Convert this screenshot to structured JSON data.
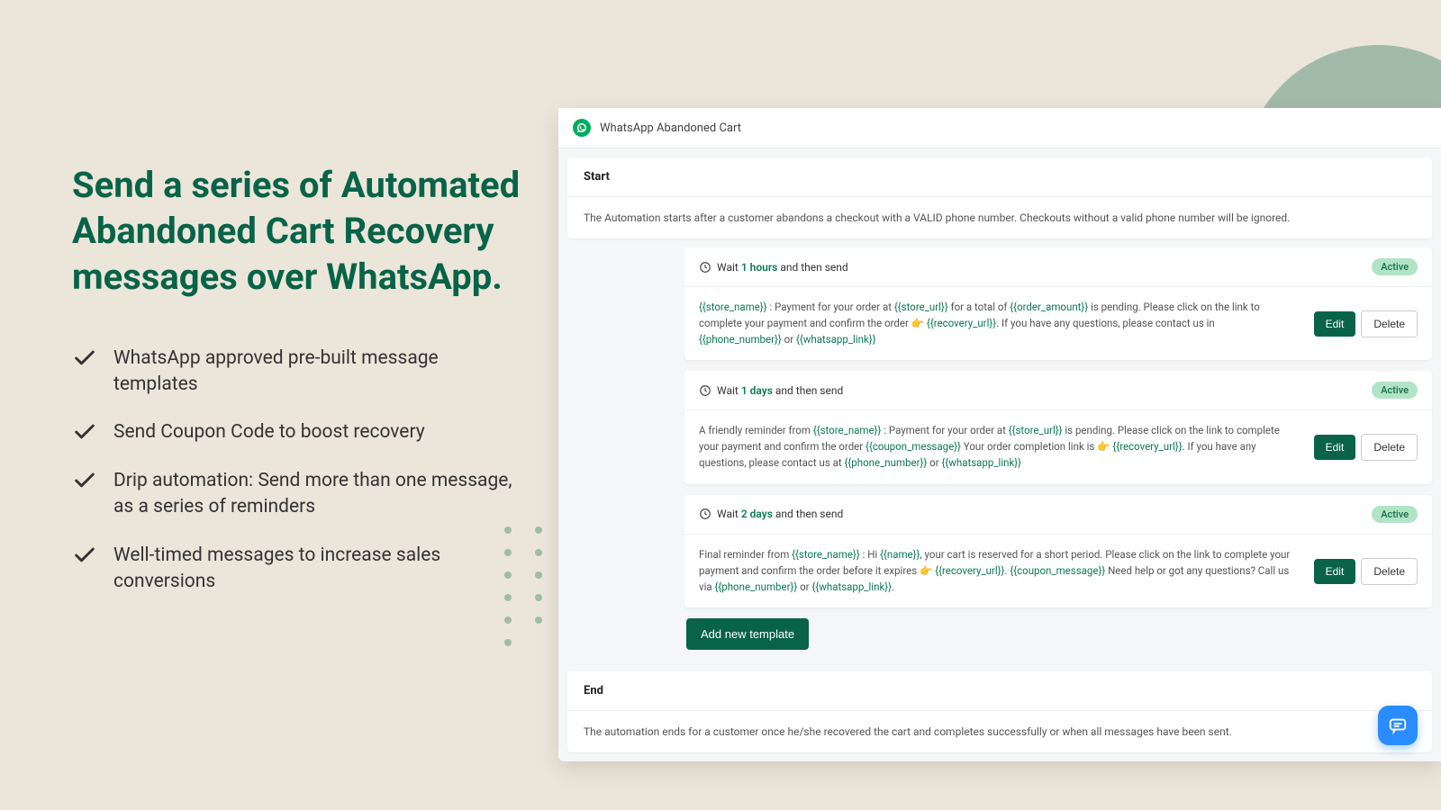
{
  "headline": "Send a series of Automated Abandoned Cart Recovery messages over WhatsApp.",
  "features": [
    "WhatsApp approved pre-built message templates",
    "Send Coupon Code to boost recovery",
    "Drip automation: Send more than one message, as a series of reminders",
    "Well-timed messages to increase sales conversions"
  ],
  "app": {
    "title": "WhatsApp Abandoned Cart",
    "start_label": "Start",
    "start_text": "The Automation starts after a customer abandons a checkout with a VALID phone number. Checkouts without a valid phone number will be ignored.",
    "end_label": "End",
    "end_text": "The automation ends for a customer once he/she recovered the cart and completes successfully or when all messages have been sent.",
    "wait_prefix": "Wait",
    "wait_suffix": "and then send",
    "active_label": "Active",
    "edit_label": "Edit",
    "delete_label": "Delete",
    "add_label": "Add new template",
    "steps": [
      {
        "wait": "1 hours",
        "msg_a": "{{store_name}} : Payment for your order at {{store_url}} for a total of {{order_amount}} is pending. Please click on the link to complete your payment and confirm the order ",
        "msg_b": " {{recovery_url}}. If you have any questions, please contact us in {{phone_number}} or {{whatsapp_link}}"
      },
      {
        "wait": "1 days",
        "msg_a": "A friendly reminder from {{store_name}} : Payment for your order at {{store_url}} is pending. Please click on the link to complete your payment and confirm the order {{coupon_message}} Your order completion link is ",
        "msg_b": " {{recovery_url}}. If you have any questions, please contact us at {{phone_number}} or {{whatsapp_link}}"
      },
      {
        "wait": "2 days",
        "msg_a": "Final reminder from {{store_name}} : Hi {{name}}, your cart is reserved for a short period. Please click on the link to complete your payment and confirm the order before it expires ",
        "msg_b": " {{recovery_url}}. {{coupon_message}} Need help or got any questions? Call us via {{phone_number}} or {{whatsapp_link}}."
      }
    ]
  }
}
